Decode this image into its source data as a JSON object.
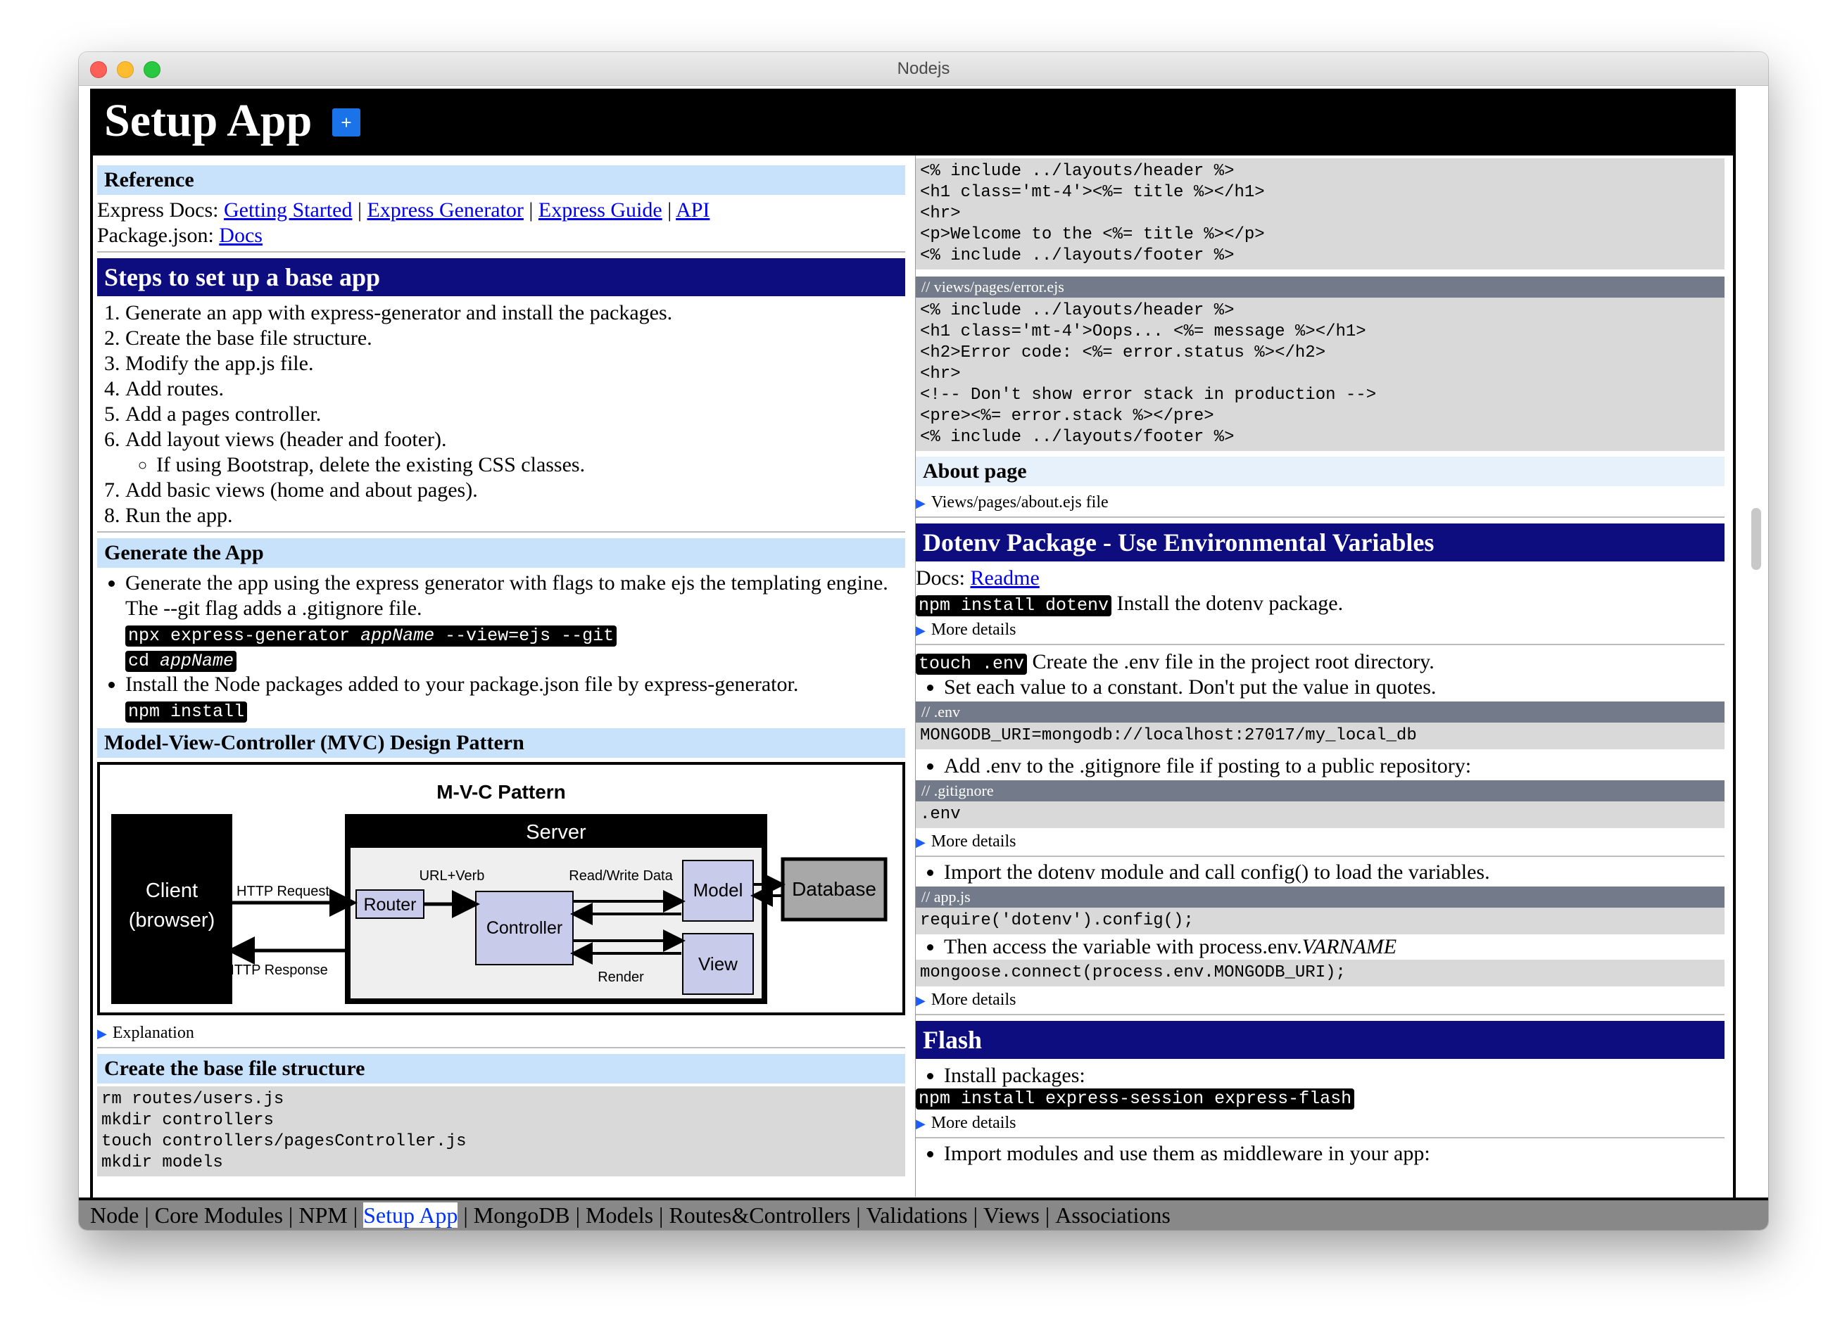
{
  "window": {
    "title": "Nodejs"
  },
  "header": {
    "title": "Setup App",
    "plus_icon": "+"
  },
  "left": {
    "reference": {
      "heading": "Reference",
      "express_prefix": "Express Docs:",
      "links": [
        "Getting Started",
        "Express Generator",
        "Express Guide",
        "API"
      ],
      "pipe": "|",
      "package_prefix": "Package.json:",
      "package_link": "Docs"
    },
    "steps": {
      "heading": "Steps to set up a base app",
      "items": [
        "Generate an app with express-generator and install the packages.",
        "Create the base file structure.",
        "Modify the app.js file.",
        "Add routes.",
        "Add a pages controller.",
        "Add layout views (header and footer).",
        "Add basic views (home and about pages).",
        "Run the app."
      ],
      "sub_item": "If using Bootstrap, delete the existing CSS classes."
    },
    "generate": {
      "heading": "Generate the App",
      "bullet1": "Generate the app using the express generator with flags to make ejs the templating engine. The --git flag adds a .gitignore file.",
      "cmd1_a": "npx express-generator ",
      "cmd1_b": "appName",
      "cmd1_c": " --view=ejs --git",
      "cmd2_a": "cd ",
      "cmd2_b": "appName",
      "bullet2": "Install the Node packages added to your package.json file by express-generator.",
      "cmd3": "npm install"
    },
    "mvc": {
      "heading": "Model-View-Controller (MVC) Design Pattern",
      "diagram_title": "M-V-C Pattern",
      "server": "Server",
      "client_line1": "Client",
      "client_line2": "(browser)",
      "http_request": "HTTP Request",
      "http_response": "HTTP Response",
      "url_verb": "URL+Verb",
      "read_write": "Read/Write Data",
      "router": "Router",
      "controller": "Controller",
      "model": "Model",
      "view": "View",
      "database": "Database",
      "render": "Render"
    },
    "explanation": "Explanation",
    "filestructure": {
      "heading": "Create the base file structure",
      "code": "rm routes/users.js\nmkdir controllers\ntouch controllers/pagesController.js\nmkdir models"
    }
  },
  "right": {
    "code_top": "<% include ../layouts/header %>\n<h1 class='mt-4'><%= title %></h1>\n<hr>\n<p>Welcome to the <%= title %></p>\n<% include ../layouts/footer %>",
    "error_label": "// views/pages/error.ejs",
    "error_code": "<% include ../layouts/header %>\n<h1 class='mt-4'>Oops... <%= message %></h1>\n<h2>Error code: <%= error.status %></h2>\n<hr>\n<!-- Don't show error stack in production -->\n<pre><%= error.stack %></pre>\n<% include ../layouts/footer %>",
    "about_heading": "About page",
    "about_details": "Views/pages/about.ejs file",
    "dotenv": {
      "heading": "Dotenv Package - Use Environmental Variables",
      "docs_prefix": "Docs:",
      "docs_link": "Readme",
      "cmd1": "npm install dotenv",
      "cmd1_text": " Install the dotenv package.",
      "more1": "More details",
      "cmd2": "touch .env",
      "cmd2_text": " Create the .env file in the project root directory.",
      "bullet1": "Set each value to a constant. Don't put the value in quotes.",
      "env_label": "// .env",
      "env_code": "MONGODB_URI=mongodb://localhost:27017/my_local_db",
      "bullet2": "Add .env to the .gitignore file if posting to a public repository:",
      "gitignore_label": "// .gitignore",
      "gitignore_code": ".env",
      "more2": "More details",
      "bullet3": "Import the dotenv module and call config() to load the variables.",
      "app_label": "// app.js",
      "app_code": "require('dotenv').config();",
      "bullet4_a": "Then access the variable with process.env.",
      "bullet4_b": "VARNAME",
      "access_code": "mongoose.connect(process.env.MONGODB_URI);",
      "more3": "More details"
    },
    "flash": {
      "heading": "Flash",
      "bullet1": "Install packages:",
      "cmd": "npm install express-session express-flash",
      "more": "More details",
      "bullet2": "Import modules and use them as middleware in your app:"
    }
  },
  "navbar": {
    "items": [
      "Node",
      "Core Modules",
      "NPM",
      "Setup App",
      "MongoDB",
      "Models",
      "Routes&Controllers",
      "Validations",
      "Views",
      "Associations"
    ],
    "active": "Setup App",
    "separator": "|"
  },
  "colors": {
    "header_bg": "#000000",
    "dark_heading": "#0d0d80",
    "light_heading": "#c8e2fb",
    "link": "#0000ee",
    "plus_button": "#1a73e8"
  }
}
